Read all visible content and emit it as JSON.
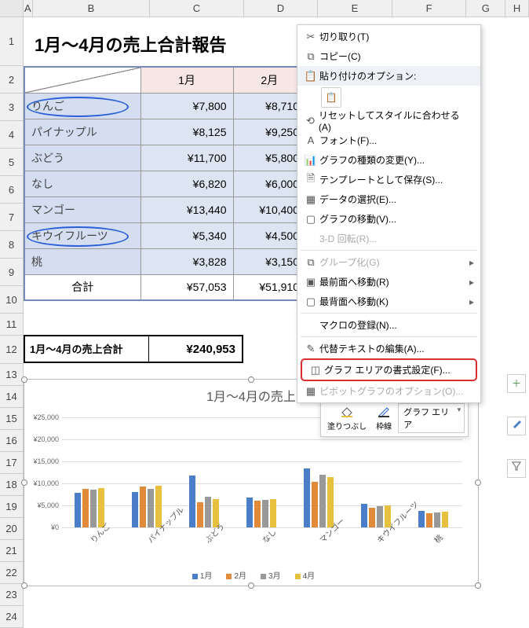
{
  "columns": [
    "A",
    "B",
    "C",
    "D",
    "E",
    "F",
    "G",
    "H"
  ],
  "rows": [
    "1",
    "2",
    "3",
    "4",
    "5",
    "6",
    "7",
    "8",
    "9",
    "10",
    "11",
    "12",
    "13",
    "14",
    "15",
    "16",
    "17",
    "18",
    "19",
    "20",
    "21",
    "22",
    "23",
    "24"
  ],
  "title": "1月～4月の売上合計報告",
  "table": {
    "headers": [
      "1月",
      "2月"
    ],
    "rows": [
      {
        "fruit": "りんご",
        "v1": "¥7,800",
        "v2": "¥8,710",
        "circled": true
      },
      {
        "fruit": "パイナップル",
        "v1": "¥8,125",
        "v2": "¥9,250",
        "circled": false
      },
      {
        "fruit": "ぶどう",
        "v1": "¥11,700",
        "v2": "¥5,800",
        "circled": false
      },
      {
        "fruit": "なし",
        "v1": "¥6,820",
        "v2": "¥6,000",
        "circled": false
      },
      {
        "fruit": "マンゴー",
        "v1": "¥13,440",
        "v2": "¥10,400",
        "circled": false
      },
      {
        "fruit": "キウイフルーツ",
        "v1": "¥5,340",
        "v2": "¥4,500",
        "circled": true
      },
      {
        "fruit": "桃",
        "v1": "¥3,828",
        "v2": "¥3,150",
        "circled": false
      }
    ],
    "footer": {
      "label": "合計",
      "v1": "¥57,053",
      "v2": "¥51,910"
    }
  },
  "summary": {
    "label": "1月～4月の売上合計",
    "value": "¥240,953"
  },
  "chart_data": {
    "type": "bar",
    "title": "1月～4月の売上",
    "categories": [
      "りんご",
      "パイナップル",
      "ぶどう",
      "なし",
      "マンゴー",
      "キウイフルーツ",
      "桃"
    ],
    "series": [
      {
        "name": "1月",
        "values": [
          7800,
          8125,
          11700,
          6820,
          13440,
          5340,
          3828
        ]
      },
      {
        "name": "2月",
        "values": [
          8710,
          9250,
          5800,
          6000,
          10400,
          4500,
          3150
        ]
      },
      {
        "name": "3月",
        "values": [
          8500,
          8800,
          7000,
          6200,
          12000,
          4800,
          3400
        ]
      },
      {
        "name": "4月",
        "values": [
          9000,
          9500,
          6500,
          6400,
          11500,
          5000,
          3600
        ]
      }
    ],
    "y_ticks": [
      0,
      5000,
      10000,
      15000,
      20000,
      25000
    ],
    "y_labels": [
      "¥0",
      "¥5,000",
      "¥10,000",
      "¥15,000",
      "¥20,000",
      "¥25,000"
    ],
    "ylim": [
      0,
      25000
    ]
  },
  "mini_toolbar": {
    "fill": "塗りつぶし",
    "outline": "枠線",
    "area_select": "グラフ エリア"
  },
  "context_menu": {
    "cut": "切り取り(T)",
    "copy": "コピー(C)",
    "paste_opts": "貼り付けのオプション:",
    "reset": "リセットしてスタイルに合わせる(A)",
    "font": "フォント(F)...",
    "change_chart": "グラフの種類の変更(Y)...",
    "save_template": "テンプレートとして保存(S)...",
    "select_data": "データの選択(E)...",
    "move_chart": "グラフの移動(V)...",
    "rotate_3d": "3-D 回転(R)...",
    "group": "グループ化(G)",
    "bring_front": "最前面へ移動(R)",
    "send_back": "最背面へ移動(K)",
    "macro": "マクロの登録(N)...",
    "alt_text": "代替テキストの編集(A)...",
    "format_area": "グラフ エリアの書式設定(F)...",
    "pivot_opts": "ピボットグラフのオプション(O)..."
  }
}
